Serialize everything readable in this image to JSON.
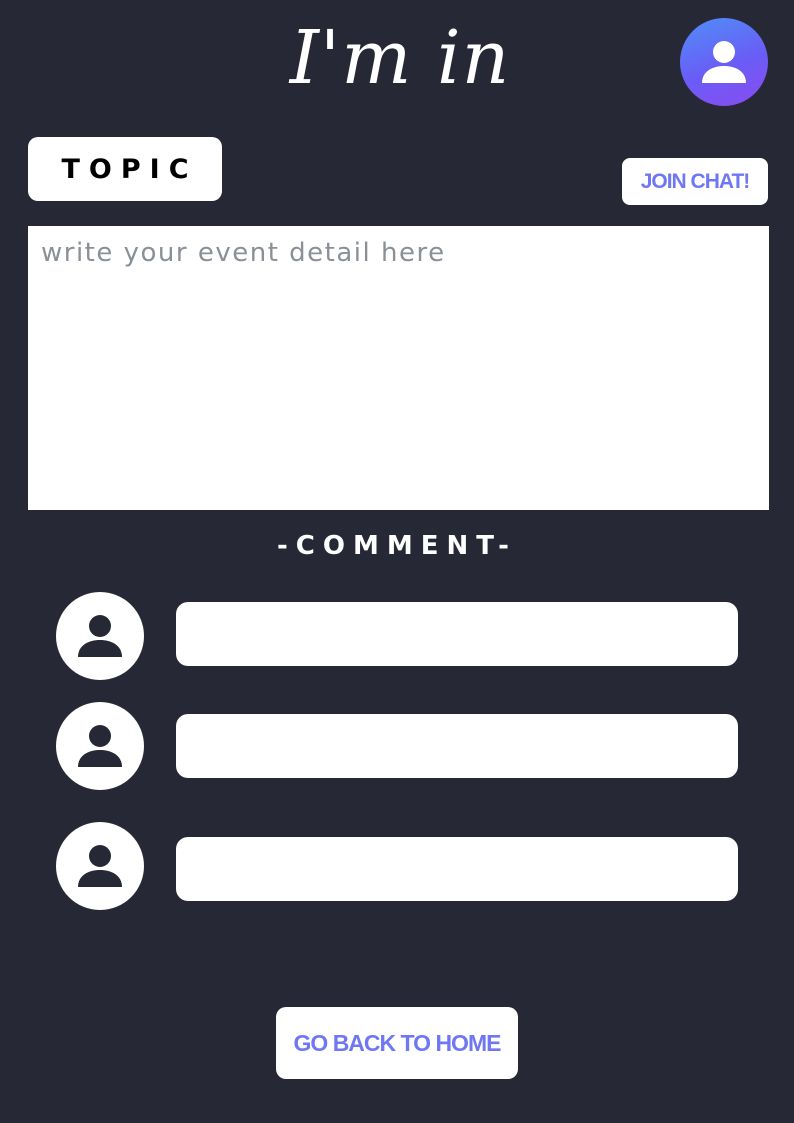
{
  "header": {
    "title": "I'm in",
    "profile_icon": "user-icon",
    "profile_gradient": [
      "#4f8ff8",
      "#8a4cf0"
    ]
  },
  "toolbar": {
    "topic_label": "TOPIC",
    "join_chat_label": "JOIN CHAT!"
  },
  "event_detail": {
    "value": "",
    "placeholder": "write your event detail here"
  },
  "comments": {
    "heading": "-COMMENT-",
    "items": [
      {
        "avatar_icon": "user-icon",
        "text": ""
      },
      {
        "avatar_icon": "user-icon",
        "text": ""
      },
      {
        "avatar_icon": "user-icon",
        "text": ""
      }
    ]
  },
  "footer": {
    "home_label": "GO BACK TO HOME"
  },
  "colors": {
    "background": "#262835",
    "accent": "#6f78f2",
    "surface": "#ffffff"
  }
}
